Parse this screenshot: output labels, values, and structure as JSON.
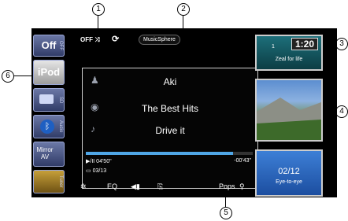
{
  "callouts": [
    "1",
    "2",
    "3",
    "4",
    "5",
    "6"
  ],
  "sources": {
    "off": "Off",
    "off_side": "OFF",
    "ipod": "iPod",
    "sd_side": "SD",
    "audio_side": "Audio",
    "mirror": "Mirror AV",
    "tuner_side": "Tuner"
  },
  "status": {
    "repeat_label": "OFF",
    "music_sphere": "MusicSphere"
  },
  "track": {
    "artist": "Aki",
    "album": "The Best Hits",
    "title": "Drive it",
    "progress": 0.88,
    "elapsed": "04'50\"",
    "remaining": "-00'43\"",
    "count": "03/13"
  },
  "bottom": {
    "eq": "EQ",
    "genre": "Pops"
  },
  "right": {
    "clock": "1:20",
    "clock_digit": "1",
    "top_caption": "Zeal for life",
    "index": "02/12",
    "bottom_caption": "Eye-to-eye"
  },
  "icons": [
    "shuffle-icon",
    "repeat-icon",
    "artist-icon",
    "album-icon",
    "music-note-icon",
    "settings-icon",
    "back-icon",
    "playlist-icon",
    "search-icon"
  ]
}
